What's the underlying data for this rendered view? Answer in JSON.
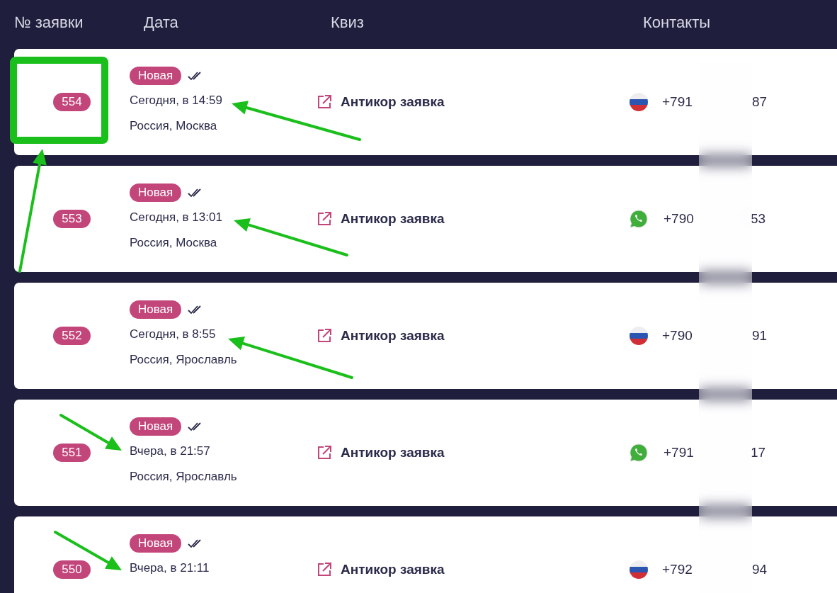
{
  "table": {
    "columns": [
      "№ заявки",
      "Дата",
      "Квиз",
      "Контакты"
    ],
    "rows": [
      {
        "number": "554",
        "status": "Новая",
        "date": "Сегодня, в 14:59",
        "location": "Россия, Москва",
        "quiz": "Антикор заявка",
        "contact": {
          "kind": "flag",
          "start": "+791",
          "end": "87"
        }
      },
      {
        "number": "553",
        "status": "Новая",
        "date": "Сегодня, в 13:01",
        "location": "Россия, Москва",
        "quiz": "Антикор заявка",
        "contact": {
          "kind": "whatsapp",
          "start": "+790",
          "end": "53"
        }
      },
      {
        "number": "552",
        "status": "Новая",
        "date": "Сегодня, в 8:55",
        "location": "Россия, Ярославль",
        "quiz": "Антикор заявка",
        "contact": {
          "kind": "flag",
          "start": "+790",
          "end": "91"
        }
      },
      {
        "number": "551",
        "status": "Новая",
        "date": "Вчера, в 21:57",
        "location": "Россия, Ярославль",
        "quiz": "Антикор заявка",
        "contact": {
          "kind": "whatsapp",
          "start": "+791",
          "end": "17"
        }
      },
      {
        "number": "550",
        "status": "Новая",
        "date": "Вчера, в 21:11",
        "quiz": "Антикор заявка",
        "contact": {
          "kind": "flag",
          "start": "+792",
          "end": "94"
        }
      }
    ]
  }
}
